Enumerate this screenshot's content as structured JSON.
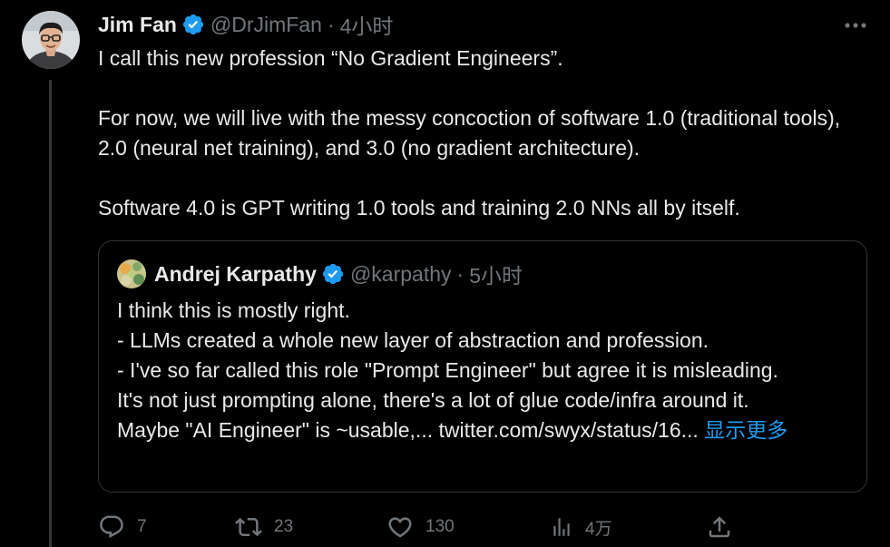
{
  "tweet": {
    "author_name": "Jim Fan",
    "handle": "@DrJimFan",
    "separator": "·",
    "time": "4小时",
    "paragraphs": [
      "I call this new profession “No Gradient Engineers”.",
      "For now, we will live with the messy concoction of software 1.0 (traditional tools), 2.0 (neural net training), and 3.0 (no gradient architecture).",
      "Software 4.0 is GPT writing 1.0 tools and training 2.0 NNs all by itself."
    ],
    "more_icon": "more-horizontal-icon"
  },
  "quote": {
    "author_name": "Andrej Karpathy",
    "handle": "@karpathy",
    "separator": "·",
    "time": "5小时",
    "lines": [
      "I think this is mostly right.",
      "- LLMs created a whole new layer of abstraction and profession.",
      "- I've so far called this role \"Prompt Engineer\" but agree it is misleading.",
      "It's not just prompting alone, there's a lot of glue code/infra around it.",
      "Maybe \"AI Engineer\" is ~usable,... twitter.com/swyx/status/16..."
    ],
    "show_more": "显示更多"
  },
  "actions": {
    "reply": {
      "icon": "reply-icon",
      "count": "7"
    },
    "retweet": {
      "icon": "retweet-icon",
      "count": "23"
    },
    "like": {
      "icon": "heart-icon",
      "count": "130"
    },
    "views": {
      "icon": "analytics-icon",
      "count": "4万"
    },
    "share": {
      "icon": "share-icon"
    }
  },
  "colors": {
    "background": "#000000",
    "text": "#e7e9ea",
    "secondary": "#71767b",
    "accent": "#1d9bf0",
    "border": "#2f3336"
  }
}
